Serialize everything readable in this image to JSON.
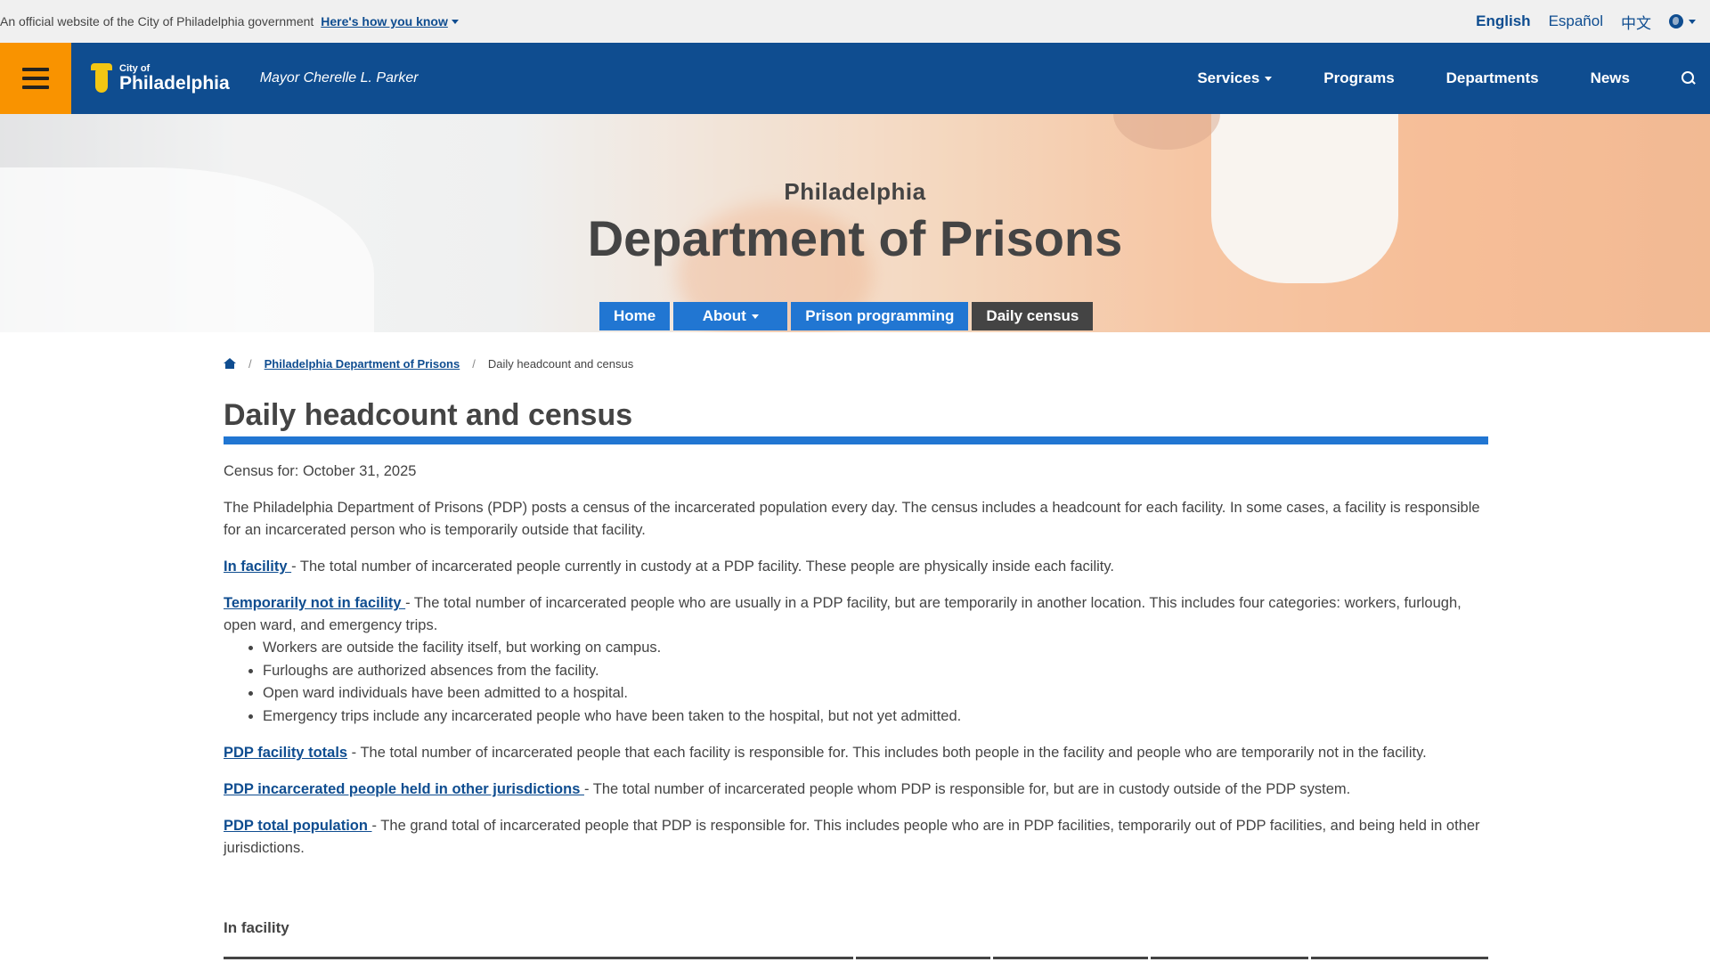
{
  "official_bar": {
    "text": "An official website of the City of Philadelphia government",
    "how_you_know": "Here's how you know",
    "languages": [
      "English",
      "Español",
      "中文"
    ],
    "active_language": "English"
  },
  "header": {
    "logo_small": "City of",
    "logo_big": "Philadelphia",
    "mayor": "Mayor Cherelle L. Parker",
    "nav": [
      "Services",
      "Programs",
      "Departments",
      "News"
    ]
  },
  "hero": {
    "subtitle": "Philadelphia",
    "title": "Department of Prisons",
    "subnav": [
      "Home",
      "About",
      "Prison programming",
      "Daily census"
    ],
    "active_subnav": "Daily census"
  },
  "breadcrumb": {
    "parent": "Philadelphia Department of Prisons",
    "current": "Daily headcount and census"
  },
  "page": {
    "title": "Daily headcount and census",
    "census_date": "Census for: October 31, 2025",
    "intro": "The Philadelphia Department of Prisons (PDP) posts a census of the incarcerated population every day. The census includes a headcount for each facility. In some cases, a facility is responsible for an incarcerated person who is temporarily outside that facility.",
    "definitions": [
      {
        "term": "In facility ",
        "text": "- The total number of incarcerated people currently in custody at a PDP facility. These people are physically inside each facility."
      },
      {
        "term": "Temporarily not in facility ",
        "text": "- The total number of incarcerated people who are usually in a PDP facility, but are temporarily in another location. This includes four categories: workers, furlough, open ward, and emergency trips."
      },
      {
        "term": "PDP facility totals",
        "text": " - The total number of incarcerated people that each facility is responsible for. This includes both people in the facility and people who are temporarily not in the facility."
      },
      {
        "term": "PDP incarcerated people held in other jurisdictions ",
        "text": "- The total number of incarcerated people whom PDP is responsible for, but are in custody outside of the PDP system."
      },
      {
        "term": "PDP total population ",
        "text": "- The grand total of incarcerated people that PDP is responsible for. This includes people who are in PDP facilities, temporarily out of PDP facilities, and being held in other jurisdictions."
      }
    ],
    "bullets": [
      "Workers are outside the facility itself, but working on campus.",
      "Furloughs are authorized absences from the facility.",
      "Open ward individuals have been admitted to a hospital.",
      "Emergency trips include any incarcerated people who have been taken to the hospital, but not yet admitted."
    ],
    "section_title": "In facility"
  },
  "colors": {
    "brand_blue": "#0f4d90",
    "accent_blue": "#2176d2",
    "menu_orange": "#f99300",
    "text_dark": "#444444"
  }
}
